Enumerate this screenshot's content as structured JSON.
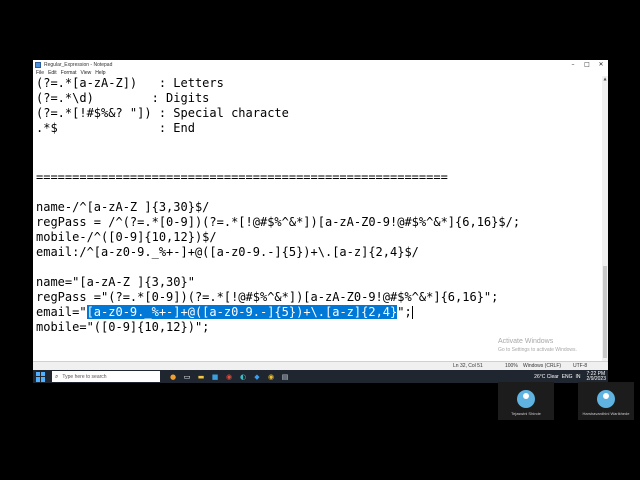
{
  "window": {
    "title": "Regular_Expression - Notepad",
    "controls": [
      "–",
      "□",
      "✕"
    ]
  },
  "menu": [
    "File",
    "Edit",
    "Format",
    "View",
    "Help"
  ],
  "lines": [
    "(?=.*[a-zA-Z])   : Letters",
    "(?=.*\\d)        : Digits",
    "(?=.*[!#$%&? \"]) : Special characte",
    ".*$              : End",
    "",
    "",
    "=========================================================",
    "",
    "name-/^[a-zA-Z ]{3,30}$/",
    "regPass = /^(?=.*[0-9])(?=.*[!@#$%^&*])[a-zA-Z0-9!@#$%^&*]{6,16}$/;",
    "mobile-/^([0-9]{10,12})$/",
    "email:/^[a-z0-9._%+-]+@([a-z0-9.-]{5})+\\.[a-z]{2,4}$/",
    "",
    "name=\"[a-zA-Z ]{3,30}\"",
    "regPass =\"(?=.*[0-9])(?=.*[!@#$%^&*])[a-zA-Z0-9!@#$%^&*]{6,16}\";",
    "",
    "mobile=\"([0-9]{10,12})\";"
  ],
  "email_line": {
    "prefix": "email=\"",
    "selected": "[a-z0-9._%+-]+@([a-z0-9.-]{5})+\\.[a-z]{2,4}",
    "suffix": "\";"
  },
  "statusbar": {
    "position": "Ln 32, Col 51",
    "zoom": "100%",
    "line_ending": "Windows (CRLF)",
    "encoding": "UTF-8"
  },
  "watermark": {
    "title": "Activate Windows",
    "subtitle": "Go to Settings to activate Windows."
  },
  "taskbar": {
    "search_placeholder": "Type here to search",
    "weather": "26°C  Clear",
    "lang": "ENG",
    "region": "IN",
    "time": "7:22 PM",
    "date": "2/9/2023"
  },
  "participants": [
    {
      "name": "Tejaswini Shinde"
    },
    {
      "name": "Harshavardhini Warikhede"
    }
  ],
  "colors": {
    "selection": "#0078d7",
    "taskbar": "#1f2630"
  }
}
